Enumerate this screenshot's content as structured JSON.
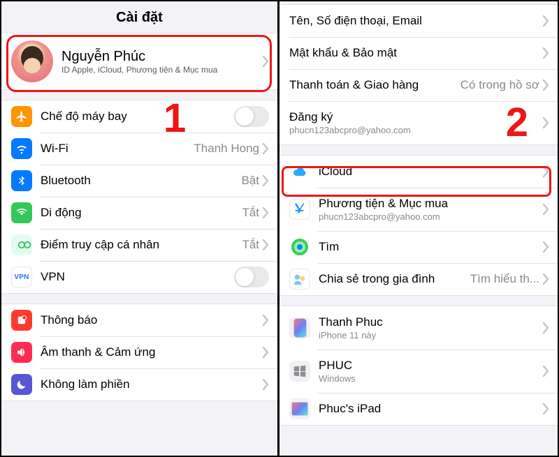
{
  "annotations": {
    "step1": "1",
    "step2": "2"
  },
  "left": {
    "title": "Cài đặt",
    "profile": {
      "name": "Nguyễn Phúc",
      "sub": "ID Apple, iCloud, Phương tiện & Mục mua"
    },
    "group1": {
      "airplane": "Chế độ máy bay",
      "wifi": "Wi-Fi",
      "wifi_value": "Thanh Hong",
      "bt": "Bluetooth",
      "bt_value": "Bật",
      "cell": "Di động",
      "cell_value": "Tắt",
      "hotspot": "Điểm truy cập cá nhân",
      "hotspot_value": "Tắt",
      "vpn": "VPN"
    },
    "group2": {
      "notif": "Thông báo",
      "sound": "Âm thanh & Cảm ứng",
      "dnd": "Không làm phiền"
    }
  },
  "right": {
    "group1": {
      "name_phone_email": "Tên, Số điện thoại, Email",
      "pw_security": "Mật khẩu & Bảo mật",
      "payment": "Thanh toán & Giao hàng",
      "payment_value": "Có trong hồ sơ",
      "subs": "Đăng ký",
      "subs_sub": "phucn123abcpro@yahoo.com"
    },
    "group2": {
      "icloud": "iCloud",
      "media": "Phương tiện & Mục mua",
      "media_sub": "phucn123abcpro@yahoo.com",
      "find": "Tìm",
      "family": "Chia sẻ trong gia đình",
      "family_value": "Tìm hiểu th..."
    },
    "devices": {
      "d1": "Thanh Phuc",
      "d1_sub": "iPhone 11 này",
      "d2": "PHUC",
      "d2_sub": "Windows",
      "d3": "Phuc's iPad"
    }
  }
}
